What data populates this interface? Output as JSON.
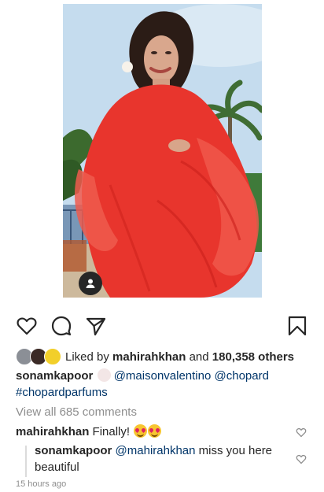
{
  "post": {
    "liked_prefix": "Liked by",
    "liked_user": "mahirahkhan",
    "liked_and": "and",
    "liked_count": "180,358 others",
    "caption_user": "sonamkapoor",
    "caption_mention1": "@maisonvalentino",
    "caption_mention2": "@chopard",
    "caption_hashtag": "#chopardparfums",
    "view_all": "View all 685 comments",
    "timestamp": "15 hours ago"
  },
  "comments": [
    {
      "user": "mahirahkhan",
      "text": "Finally!"
    },
    {
      "user": "sonamkapoor",
      "mention": "@mahirahkhan",
      "text": "miss you here beautiful"
    }
  ],
  "icons": {
    "like": "heart-icon",
    "comment": "comment-icon",
    "share": "direct-share-icon",
    "save": "bookmark-icon",
    "tags": "user-tags-icon"
  },
  "colors": {
    "dress": "#e8352d",
    "link": "#003569",
    "muted": "#8e8e8e"
  }
}
